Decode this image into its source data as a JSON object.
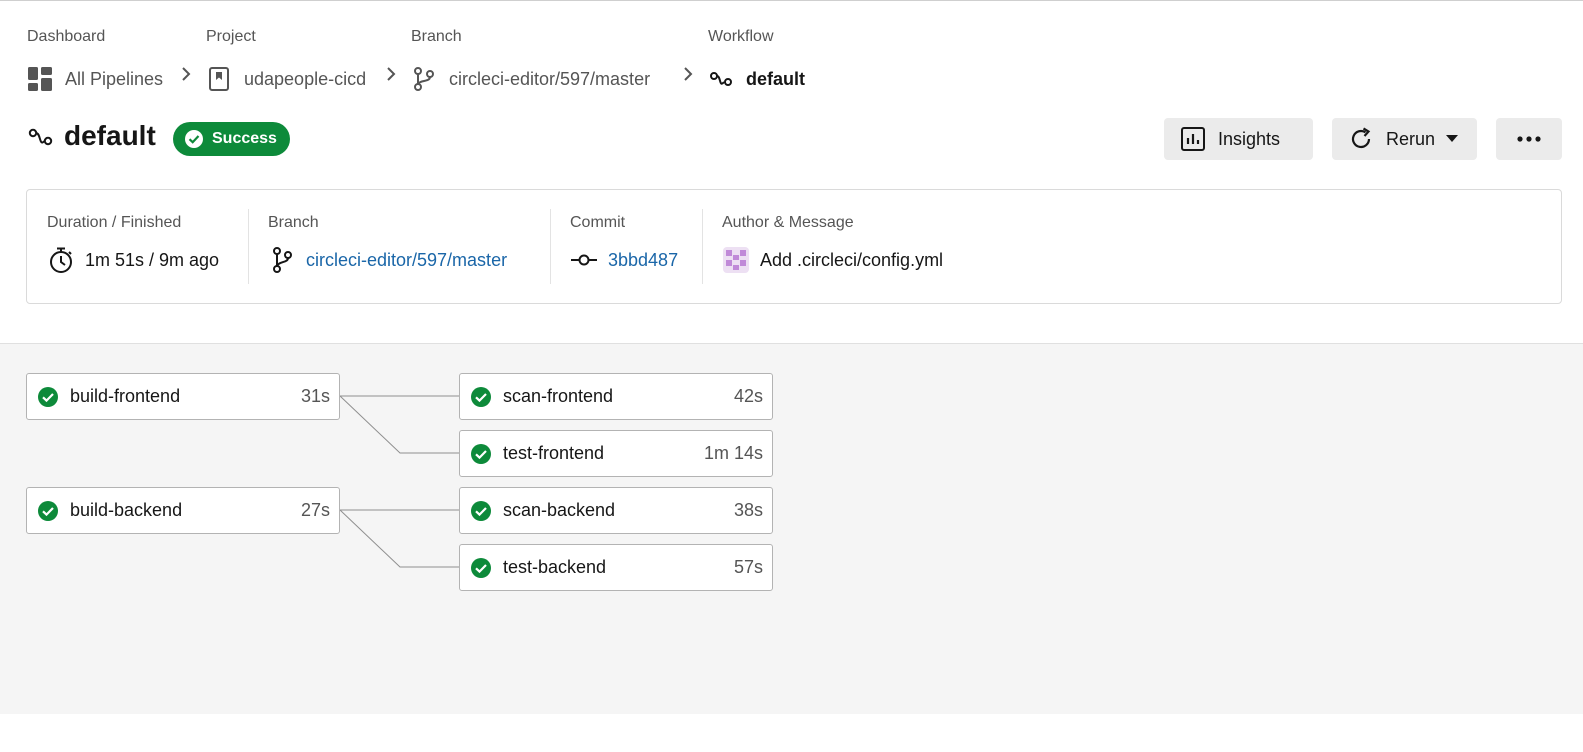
{
  "breadcrumbs": [
    {
      "label": "Dashboard",
      "value": "All Pipelines",
      "icon": "dashboard-icon"
    },
    {
      "label": "Project",
      "value": "udapeople-cicd",
      "icon": "project-bookmark-icon"
    },
    {
      "label": "Branch",
      "value": "circleci-editor/597/master",
      "icon": "branch-icon"
    },
    {
      "label": "Workflow",
      "value": "default",
      "icon": "workflow-icon"
    }
  ],
  "workflow": {
    "title": "default",
    "status": "Success",
    "status_color": "#0d8a3a"
  },
  "actions": {
    "insights_label": "Insights",
    "rerun_label": "Rerun",
    "more_icon": "more-horizontal-icon"
  },
  "info": {
    "duration_label": "Duration / Finished",
    "duration_value": "1m 51s / 9m ago",
    "branch_label": "Branch",
    "branch_value": "circleci-editor/597/master",
    "commit_label": "Commit",
    "commit_value": "3bbd487",
    "author_label": "Author & Message",
    "author_message": "Add .circleci/config.yml"
  },
  "colors": {
    "link": "#1a66a8",
    "success": "#0d8a3a",
    "graph_bg": "#f5f5f5"
  },
  "jobs": [
    {
      "name": "build-frontend",
      "duration": "31s",
      "status": "success"
    },
    {
      "name": "scan-frontend",
      "duration": "42s",
      "status": "success"
    },
    {
      "name": "test-frontend",
      "duration": "1m 14s",
      "status": "success"
    },
    {
      "name": "build-backend",
      "duration": "27s",
      "status": "success"
    },
    {
      "name": "scan-backend",
      "duration": "38s",
      "status": "success"
    },
    {
      "name": "test-backend",
      "duration": "57s",
      "status": "success"
    }
  ]
}
